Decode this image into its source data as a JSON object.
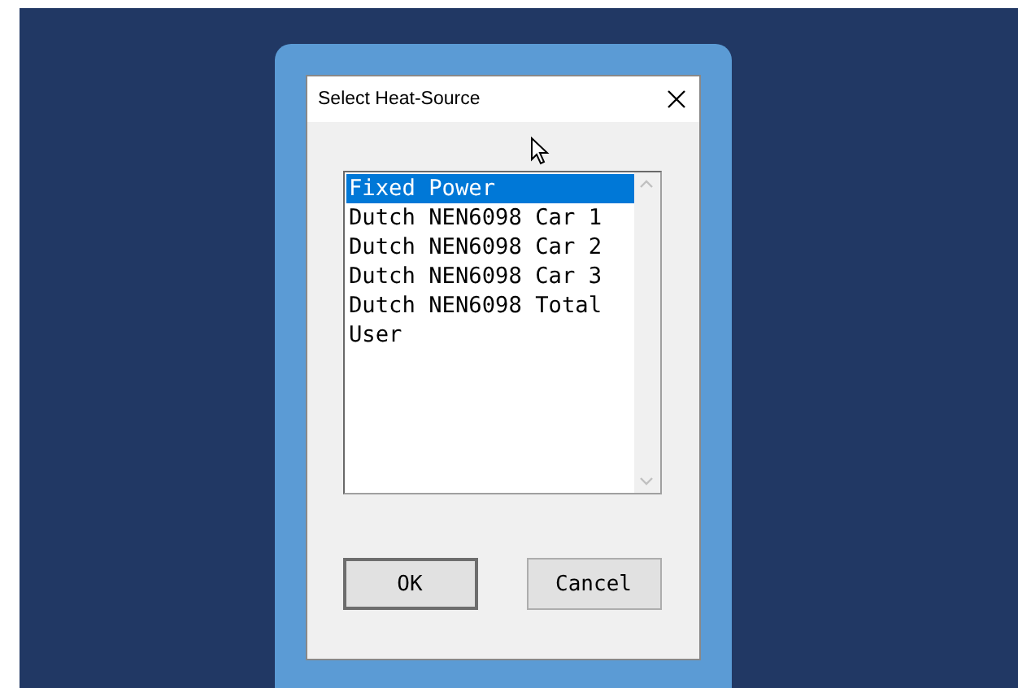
{
  "window": {
    "title": "Select Heat-Source"
  },
  "list": {
    "items": [
      {
        "label": "Fixed Power",
        "selected": true
      },
      {
        "label": "Dutch NEN6098 Car 1",
        "selected": false
      },
      {
        "label": "Dutch NEN6098 Car 2",
        "selected": false
      },
      {
        "label": "Dutch NEN6098 Car 3",
        "selected": false
      },
      {
        "label": "Dutch NEN6098 Total",
        "selected": false
      },
      {
        "label": "User",
        "selected": false
      }
    ]
  },
  "buttons": [
    {
      "label": "OK",
      "kind": "default"
    },
    {
      "label": "Cancel",
      "kind": "normal"
    }
  ]
}
